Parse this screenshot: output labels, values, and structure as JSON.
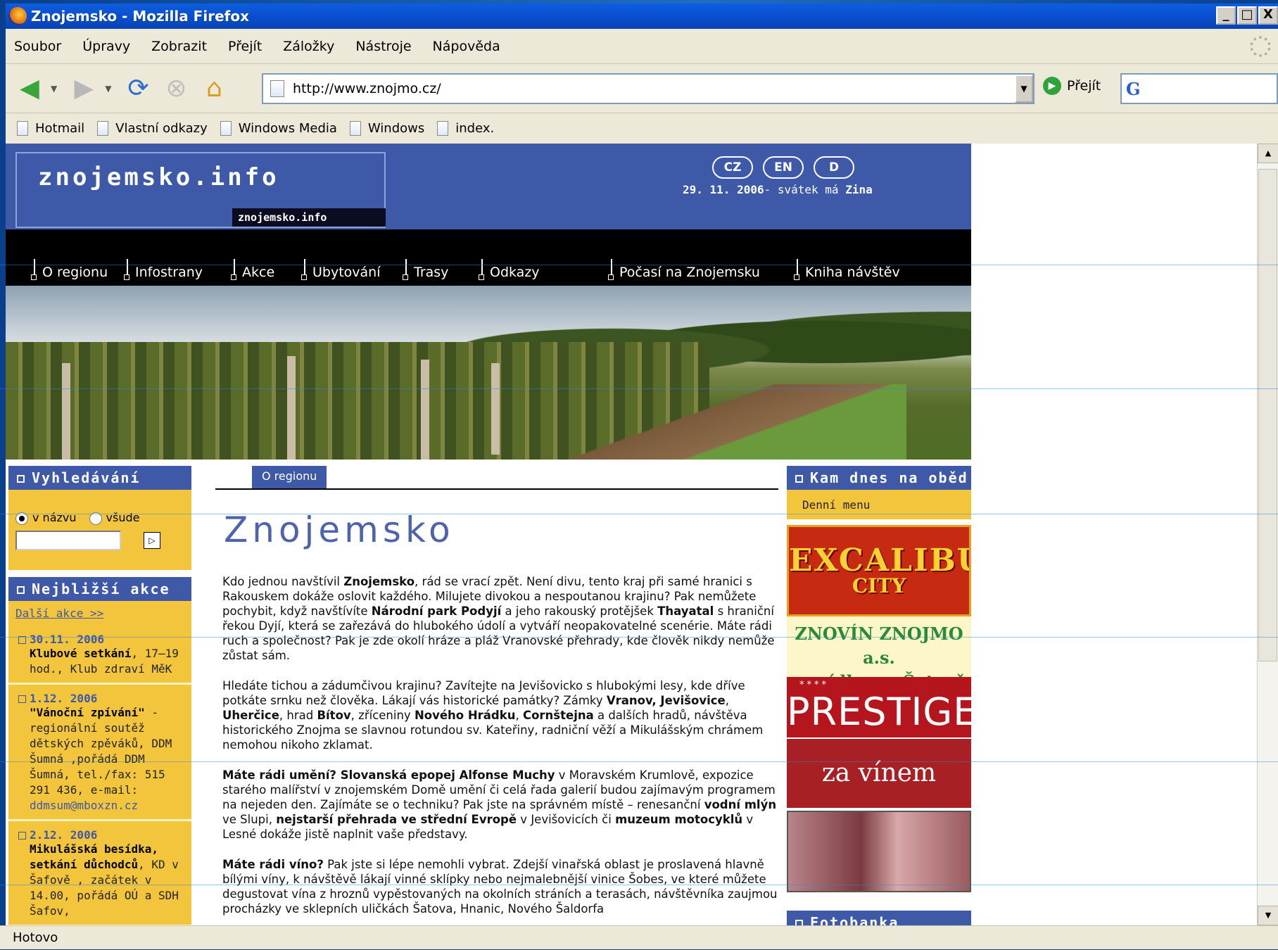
{
  "window": {
    "title": "Znojemsko - Mozilla Firefox",
    "controls": [
      "_",
      "□",
      "X"
    ]
  },
  "menubar": [
    "Soubor",
    "Úpravy",
    "Zobrazit",
    "Přejít",
    "Záložky",
    "Nástroje",
    "Nápověda"
  ],
  "navbar": {
    "url": "http://www.znojmo.cz/",
    "go_label": "Přejít",
    "search_logo": "G"
  },
  "bookmarks": [
    "Hotmail",
    "Vlastní odkazy",
    "Windows Media",
    "Windows",
    "index."
  ],
  "site": {
    "logo_text": "znojemsko.info",
    "logo_small": "znojemsko.info",
    "langs": [
      "CZ",
      "EN",
      "D"
    ],
    "date": "29. 11. 2006",
    "nameday_text": "- svátek má",
    "nameday_name": "Zina",
    "topnav": [
      "O regionu",
      "Infostrany",
      "Akce",
      "Ubytování",
      "Trasy",
      "Odkazy",
      "Počasí na Znojemsku",
      "Kniha návštěv"
    ],
    "search": {
      "title": "Vyhledávání",
      "opt1": "v názvu",
      "opt2": "všude",
      "go": "▷"
    },
    "events": {
      "title": "Nejbližší akce",
      "more": "Další akce >>",
      "items": [
        {
          "date": "30.11. 2006",
          "name": "Klubové setkání",
          "rest": ", 17–19 hod., Klub zdraví MěK",
          "link": ""
        },
        {
          "date": "1.12. 2006",
          "name": "\"Vánoční zpívání\"",
          "rest": " - regionální soutěž dětských zpěváků, DDM Šumná ,pořádá DDM Šumná, tel./fax: 515 291 436, e-mail:",
          "link": "ddmsum@mboxzn.cz"
        },
        {
          "date": "2.12. 2006",
          "name": "Mikulášská besídka, setkání důchodců",
          "rest": ", KD v Šafově , začátek v 14.00, pořádá OÚ a SDH Šafov,",
          "link": ""
        }
      ]
    },
    "breadcrumb": "O regionu",
    "page_title": "Znojemsko",
    "paragraphs": [
      [
        {
          "t": "Kdo jednou navštívil "
        },
        {
          "b": "Znojemsko"
        },
        {
          "t": ", rád se vrací zpět. Není divu, tento kraj při samé hranici s Rakouskem dokáže oslovit každého. Milujete divokou a nespoutanou krajinu? Pak nemůžete pochybit, když navštívíte "
        },
        {
          "b": "Národní park Podyjí"
        },
        {
          "t": " a jeho rakouský protějšek "
        },
        {
          "b": "Thayatal"
        },
        {
          "t": " s hraniční řekou Dyjí, která se zařezává do hlubokého údolí a vytváří neopakovatelné scenérie. Máte rádi ruch a společnost? Pak je zde okolí hráze a pláž Vranovské přehrady, kde člověk nikdy nemůže zůstat sám."
        }
      ],
      [
        {
          "t": "Hledáte tichou a zádumčivou krajinu? Zavítejte na Jevišovicko s hlubokými lesy, kde dříve potkáte srnku než člověka. Lákají vás historické památky? Zámky "
        },
        {
          "b": "Vranov, Jevišovice"
        },
        {
          "t": ", "
        },
        {
          "b": "Uherčice"
        },
        {
          "t": ", hrad "
        },
        {
          "b": "Bítov"
        },
        {
          "t": ", zříceniny "
        },
        {
          "b": "Nového Hrádku"
        },
        {
          "t": ", "
        },
        {
          "b": "Cornštejna"
        },
        {
          "t": " a dalších hradů, návštěva historického Znojma se slavnou rotundou sv. Kateřiny, radniční věží a Mikulášským chrámem nemohou nikoho zklamat."
        }
      ],
      [
        {
          "b": "Máte rádi umění? Slovanská epopej Alfonse Muchy"
        },
        {
          "t": " v Moravském Krumlově, expozice starého malířství v znojemském Domě umění či celá řada galerií budou zajímavým programem na nejeden den. Zajímáte se o techniku? Pak jste na správném místě – renesanční "
        },
        {
          "b": "vodní mlýn"
        },
        {
          "t": " ve Slupi, "
        },
        {
          "b": "nejstarší přehrada ve střední Evropě"
        },
        {
          "t": " v Jevišovicích či "
        },
        {
          "b": "muzeum motocyklů"
        },
        {
          "t": " v Lesné dokáže jistě naplnit vaše představy."
        }
      ],
      [
        {
          "b": "Máte rádi víno?"
        },
        {
          "t": " Pak jste si lépe nemohli vybrat. Zdejší vinařská oblast je proslavená hlavně bílými víny, k návštěvě lákají vinné sklípky nebo nejmalebnější vinice Šobes, ve které můžete degustovat vína z hroznů vypěstovaných na okolních stráních a terasách, návštěvníka zaujmou procházky ve sklepních uličkách Šatova, Hnanic, Nového Šaldorfa"
        }
      ]
    ],
    "lunch": {
      "title": "Kam dnes na oběd",
      "menu": "Denní menu"
    },
    "ads": {
      "excalibur": "EXCALIBUR",
      "excalibur_sub": "CITY",
      "znovin1": "ZNOVÍN ZNOJMO a.s.",
      "znovin2": "se sídlem v Šatově",
      "prestige_stars": "****",
      "prestige": "PRESTIGE",
      "vinem": "za vínem"
    },
    "fotobanka": "Fotobanka"
  },
  "status": "Hotovo"
}
